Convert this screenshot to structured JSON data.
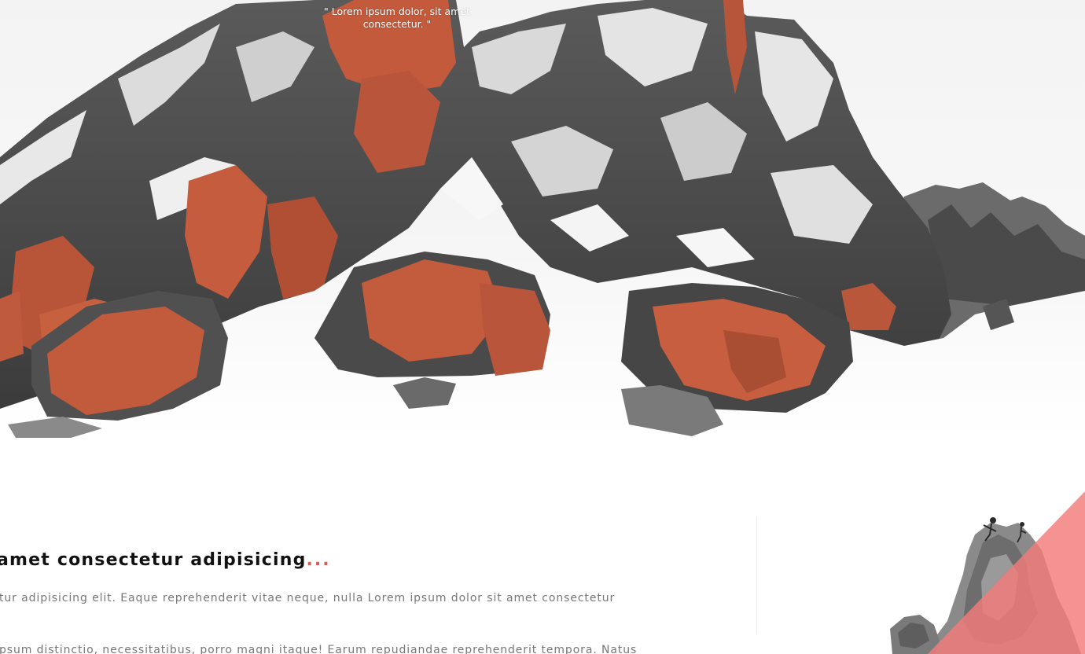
{
  "hero": {
    "quote": "\" Lorem ipsum dolor, sit amet consectetur. \""
  },
  "article": {
    "heading": "amet consectetur adipisicing",
    "heading_accent": "...",
    "paragraph_1": "tur adipisicing elit. Eaque reprehenderit vitae neque, nulla Lorem ipsum dolor sit amet consectetur",
    "paragraph_2": "psum distinctio, necessitatibus, porro magni itaque! Earum repudiandae reprehenderit tempora. Natus"
  },
  "colors": {
    "accent": "#e0584f",
    "overlay": "#f37a7a",
    "heading": "#111111",
    "body_text": "#777777"
  }
}
